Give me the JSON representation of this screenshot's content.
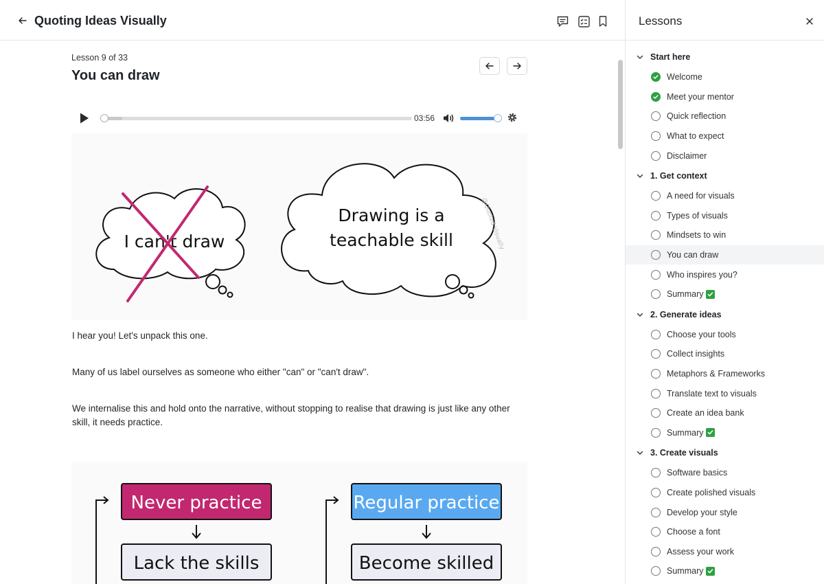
{
  "header": {
    "course_title": "Quoting Ideas Visually",
    "icons": [
      "back-arrow-icon",
      "comment-icon",
      "checklist-icon",
      "bookmark-icon"
    ]
  },
  "lesson": {
    "number_text": "Lesson 9 of 33",
    "title": "You can draw"
  },
  "player": {
    "time": "03:56",
    "progress": 0.0,
    "volume": 1.0
  },
  "illustration_1": {
    "left_cloud_text": "I can't draw",
    "right_cloud_line1": "Drawing is a",
    "right_cloud_line2": "teachable skill",
    "watermark": "@Quoted Visually"
  },
  "paragraphs": {
    "p1": "I hear you! Let's unpack this one.",
    "p2": "Many of us label ourselves as someone who either \"can\" or \"can't draw\".",
    "p3": "We internalise this and hold onto the narrative, without stopping to realise that drawing is just like any other skill, it needs practice."
  },
  "illustration_2": {
    "left_top": "Never practice",
    "left_bottom": "Lack the skills",
    "right_top": "Regular practice",
    "right_bottom": "Become skilled",
    "colors": {
      "never": "#c2286f",
      "regular": "#5aa9f0",
      "box": "#ececf4"
    }
  },
  "sidebar": {
    "title": "Lessons",
    "sections": [
      {
        "label": "Start here",
        "items": [
          {
            "label": "Welcome",
            "done": true
          },
          {
            "label": "Meet your mentor",
            "done": true
          },
          {
            "label": "Quick reflection",
            "done": false
          },
          {
            "label": "What to expect",
            "done": false
          },
          {
            "label": "Disclaimer",
            "done": false
          }
        ]
      },
      {
        "label": "1. Get context",
        "items": [
          {
            "label": "A need for visuals",
            "done": false
          },
          {
            "label": "Types of visuals",
            "done": false
          },
          {
            "label": "Mindsets to win",
            "done": false
          },
          {
            "label": "You can draw",
            "done": false,
            "active": true
          },
          {
            "label": "Who inspires you?",
            "done": false
          },
          {
            "label": "Summary",
            "done": false,
            "emoji": true
          }
        ]
      },
      {
        "label": "2. Generate ideas",
        "items": [
          {
            "label": "Choose your tools",
            "done": false
          },
          {
            "label": "Collect insights",
            "done": false
          },
          {
            "label": "Metaphors & Frameworks",
            "done": false
          },
          {
            "label": "Translate text to visuals",
            "done": false
          },
          {
            "label": "Create an idea bank",
            "done": false
          },
          {
            "label": "Summary",
            "done": false,
            "emoji": true
          }
        ]
      },
      {
        "label": "3. Create visuals",
        "items": [
          {
            "label": "Software basics",
            "done": false
          },
          {
            "label": "Create polished visuals",
            "done": false
          },
          {
            "label": "Develop your style",
            "done": false
          },
          {
            "label": "Choose a font",
            "done": false
          },
          {
            "label": "Assess your work",
            "done": false
          },
          {
            "label": "Summary",
            "done": false,
            "emoji": true
          }
        ]
      }
    ]
  }
}
